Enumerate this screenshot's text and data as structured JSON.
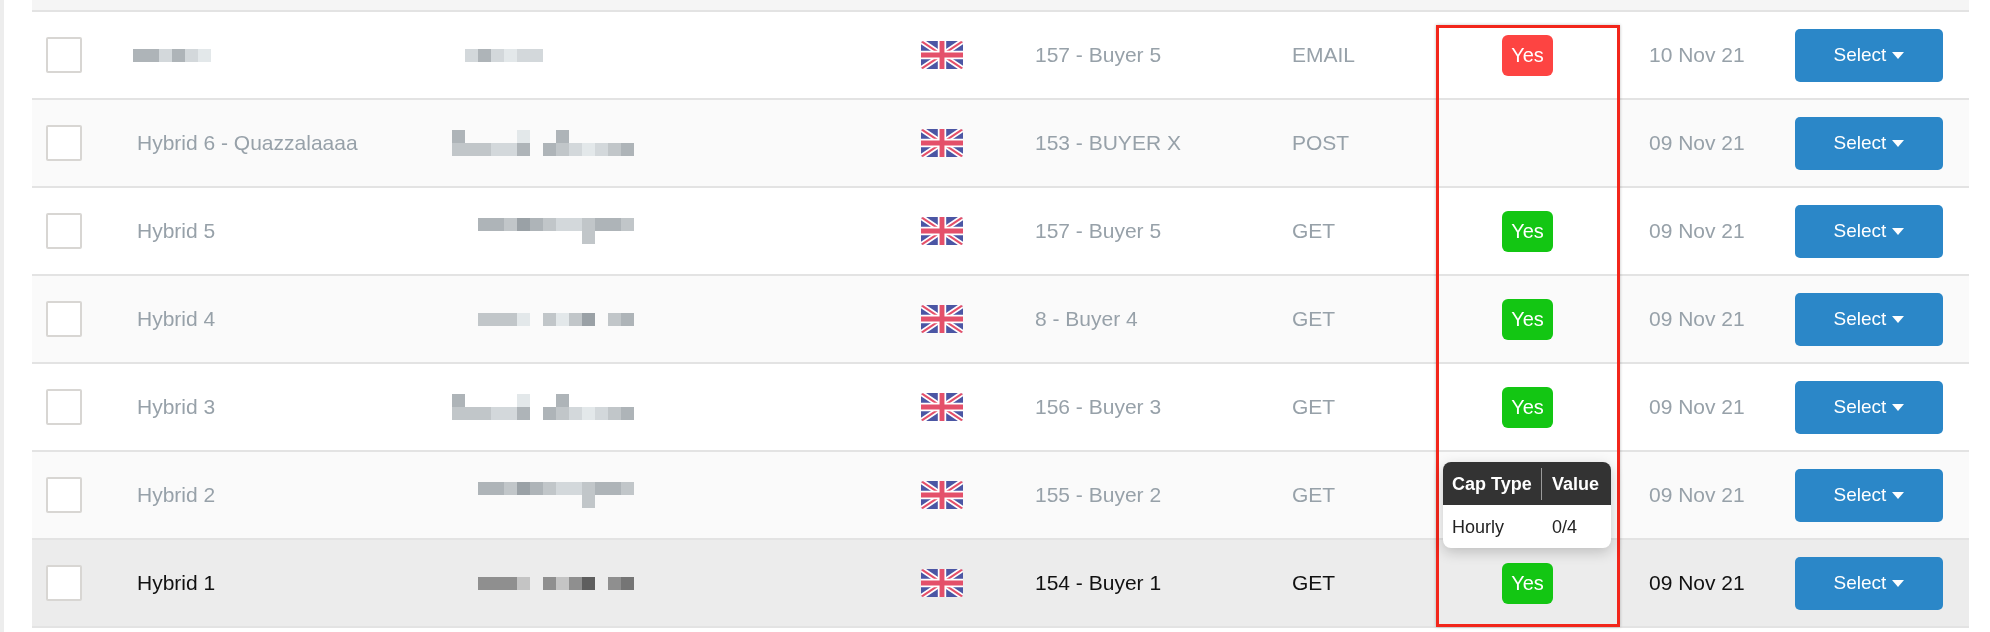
{
  "table": {
    "rows": [
      {
        "checked": false,
        "hovered": false,
        "buyer": "157 - Buyer 5",
        "method": "EMAIL",
        "cap_badge": {
          "text": "Yes",
          "color": "#fd4442"
        },
        "date": "10 Nov 21",
        "action": "Select"
      },
      {
        "checked": false,
        "hovered": false,
        "name": "Hybrid 6 - Quazzalaaaa",
        "buyer": "153 - BUYER X",
        "method": "POST",
        "date": "09 Nov 21",
        "action": "Select"
      },
      {
        "checked": false,
        "hovered": false,
        "name": "Hybrid 5",
        "buyer": "157 - Buyer 5",
        "method": "GET",
        "cap_badge": {
          "text": "Yes",
          "color": "#13c613"
        },
        "date": "09 Nov 21",
        "action": "Select"
      },
      {
        "checked": false,
        "hovered": false,
        "name": "Hybrid 4",
        "buyer": "8 - Buyer 4",
        "method": "GET",
        "cap_badge": {
          "text": "Yes",
          "color": "#13c613"
        },
        "date": "09 Nov 21",
        "action": "Select"
      },
      {
        "checked": false,
        "hovered": false,
        "name": "Hybrid 3",
        "buyer": "156 - Buyer 3",
        "method": "GET",
        "cap_badge": {
          "text": "Yes",
          "color": "#13c613"
        },
        "date": "09 Nov 21",
        "action": "Select"
      },
      {
        "checked": false,
        "hovered": false,
        "name": "Hybrid 2",
        "buyer": "155 - Buyer 2",
        "method": "GET",
        "date": "09 Nov 21",
        "action": "Select"
      },
      {
        "checked": false,
        "hovered": true,
        "name": "Hybrid 1",
        "buyer": "154 - Buyer 1",
        "method": "GET",
        "cap_badge": {
          "text": "Yes",
          "color": "#13c613"
        },
        "date": "09 Nov 21",
        "action": "Select"
      }
    ]
  },
  "cap_tooltip": {
    "columns": [
      "Cap Type",
      "Value"
    ],
    "rows": [
      [
        "Hourly",
        "0/4"
      ]
    ]
  }
}
